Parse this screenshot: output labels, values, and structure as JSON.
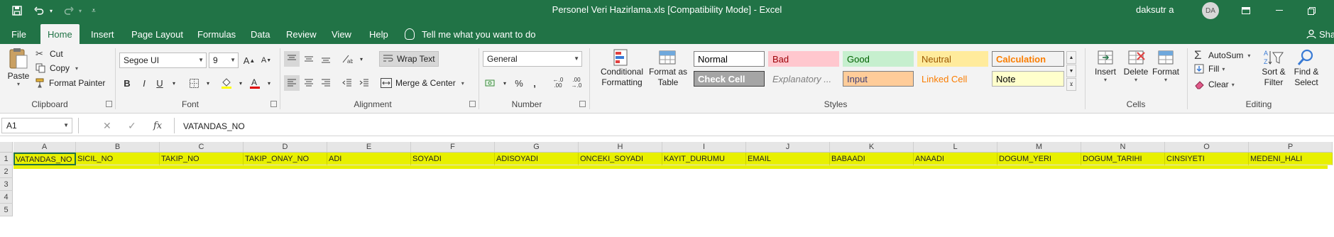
{
  "titlebar": {
    "title": "Personel Veri Hazirlama.xls  [Compatibility Mode]  -  Excel",
    "user": "daksutr a",
    "avatar": "DA",
    "icons": [
      "save-icon",
      "undo-icon",
      "redo-icon",
      "customize-qat-icon",
      "ribbon-display-icon",
      "minimize-icon",
      "restore-icon"
    ]
  },
  "menu": {
    "tabs": [
      "File",
      "Home",
      "Insert",
      "Page Layout",
      "Formulas",
      "Data",
      "Review",
      "View",
      "Help"
    ],
    "active": "Home",
    "tell_me": "Tell me what you want to do",
    "share": "Sha"
  },
  "ribbon": {
    "clipboard": {
      "label": "Clipboard",
      "paste": "Paste",
      "cut": "Cut",
      "copy": "Copy",
      "format_painter": "Format Painter"
    },
    "font": {
      "label": "Font",
      "name": "Segoe UI",
      "size": "9",
      "bold": "B",
      "italic": "I",
      "underline": "U"
    },
    "alignment": {
      "label": "Alignment",
      "wrap_text": "Wrap Text",
      "merge_center": "Merge & Center"
    },
    "number": {
      "label": "Number",
      "format": "General",
      "percent": "%",
      "comma": ",",
      "inc_dec": "←.0 .00",
      "dec_dec": ".00 →.0"
    },
    "styles": {
      "label": "Styles",
      "conditional": "Conditional Formatting",
      "format_table": "Format as Table",
      "cells": [
        {
          "name": "Normal",
          "bg": "#ffffff",
          "fg": "#000000",
          "border": "#7f7f7f"
        },
        {
          "name": "Bad",
          "bg": "#ffc7ce",
          "fg": "#9c0006",
          "border": "#ffc7ce"
        },
        {
          "name": "Good",
          "bg": "#c6efce",
          "fg": "#006100",
          "border": "#c6efce"
        },
        {
          "name": "Neutral",
          "bg": "#ffeb9c",
          "fg": "#9c5700",
          "border": "#ffeb9c"
        },
        {
          "name": "Calculation",
          "bg": "#f2f2f2",
          "fg": "#fa7d00",
          "border": "#7f7f7f"
        },
        {
          "name": "Check Cell",
          "bg": "#a5a5a5",
          "fg": "#ffffff",
          "border": "#3f3f3f"
        },
        {
          "name": "Explanatory ...",
          "bg": "#f3f3f3",
          "fg": "#7f7f7f",
          "border": "#f3f3f3"
        },
        {
          "name": "Input",
          "bg": "#ffcc99",
          "fg": "#3f3f76",
          "border": "#7f7f7f"
        },
        {
          "name": "Linked Cell",
          "bg": "#f3f3f3",
          "fg": "#fa7d00",
          "border": "#f3f3f3"
        },
        {
          "name": "Note",
          "bg": "#ffffcc",
          "fg": "#000000",
          "border": "#b2b2b2"
        }
      ]
    },
    "cells": {
      "label": "Cells",
      "insert": "Insert",
      "delete": "Delete",
      "format": "Format"
    },
    "editing": {
      "label": "Editing",
      "autosum": "AutoSum",
      "fill": "Fill",
      "clear": "Clear",
      "sort_filter": "Sort & Filter",
      "find_select": "Find & Select"
    }
  },
  "formula_bar": {
    "name_box": "A1",
    "fx": "fx",
    "content": "VATANDAS_NO"
  },
  "grid": {
    "columns": [
      "A",
      "B",
      "C",
      "D",
      "E",
      "F",
      "G",
      "H",
      "I",
      "J",
      "K",
      "L",
      "M",
      "N",
      "O",
      "P"
    ],
    "rows": [
      "1",
      "2",
      "3",
      "4",
      "5"
    ],
    "row1": [
      "VATANDAS_NO",
      "SICIL_NO",
      "TAKIP_NO",
      "TAKIP_ONAY_NO",
      "ADI",
      "SOYADI",
      "ADISOYADI",
      "ONCEKI_SOYADI",
      "KAYIT_DURUMU",
      "EMAIL",
      "BABAADI",
      "ANAADI",
      "DOGUM_YERI",
      "DOGUM_TARIHI",
      "CINSIYETI",
      "MEDENI_HALI"
    ],
    "highlight_color": "#e8f000",
    "selected_cell": "A1"
  }
}
